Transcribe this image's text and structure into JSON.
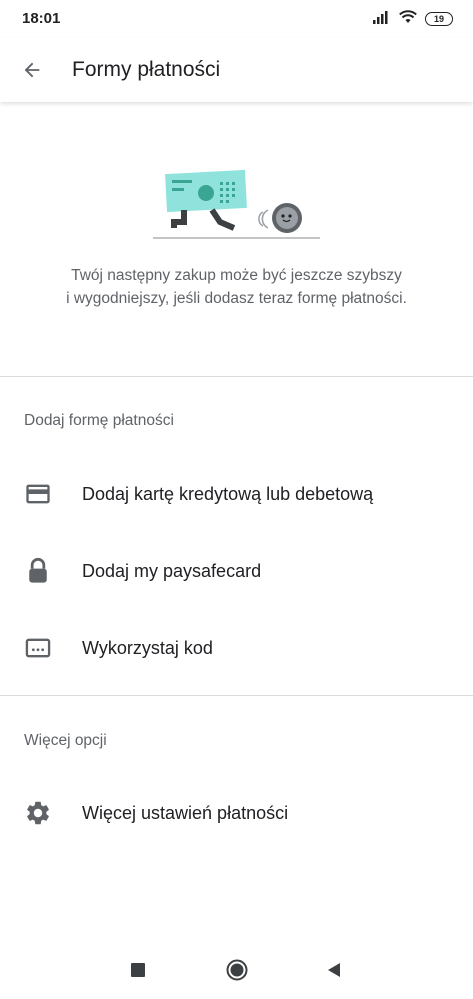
{
  "status_bar": {
    "time": "18:01",
    "battery": "19",
    "icons": [
      "signal-icon",
      "wifi-icon",
      "battery-icon"
    ]
  },
  "app_bar": {
    "title": "Formy płatności",
    "back_icon": "arrow-back-icon"
  },
  "hero": {
    "illustration": "running-banknote-illustration",
    "text_line1": "Twój następny zakup może być jeszcze szybszy",
    "text_line2": "i wygodniejszy, jeśli dodasz teraz formę płatności."
  },
  "add_section": {
    "header": "Dodaj formę płatności",
    "items": [
      {
        "label": "Dodaj kartę kredytową lub debetową",
        "icon": "credit-card-icon"
      },
      {
        "label": "Dodaj my paysafecard",
        "icon": "lock-icon"
      },
      {
        "label": "Wykorzystaj kod",
        "icon": "redeem-code-icon"
      }
    ]
  },
  "more_section": {
    "header": "Więcej opcji",
    "items": [
      {
        "label": "Więcej ustawień płatności",
        "icon": "gear-icon"
      }
    ]
  },
  "nav_bar": {
    "icons": [
      "recents-square-icon",
      "home-circle-icon",
      "back-triangle-icon"
    ]
  },
  "colors": {
    "illustration_teal": "#8fe3dc",
    "illustration_green": "#3aa592",
    "text_secondary": "#5f6368",
    "icon_gray": "#5f6368"
  }
}
